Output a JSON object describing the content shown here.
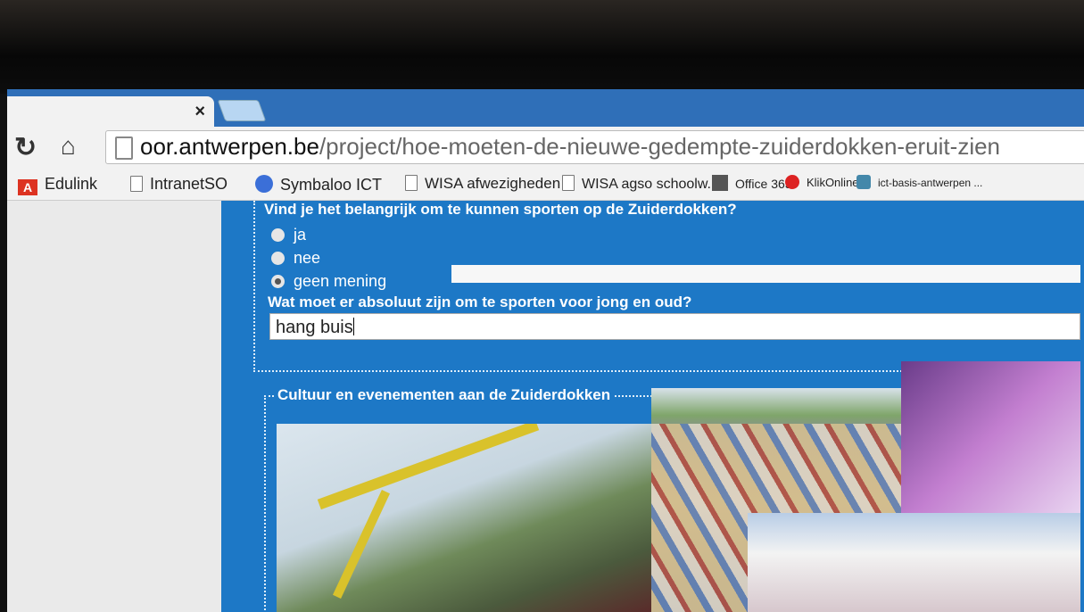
{
  "browser": {
    "tab_close": "×",
    "url_host": "oor.antwerpen.be",
    "url_path": "/project/hoe-moeten-de-nieuwe-gedempte-zuiderdokken-eruit-zien"
  },
  "bookmarks": [
    {
      "label": "Edulink",
      "icon": "acrobat-icon"
    },
    {
      "label": "IntranetSO",
      "icon": "page-icon"
    },
    {
      "label": "Symbaloo ICT",
      "icon": "symbaloo-icon"
    },
    {
      "label": "WISA afwezigheden",
      "icon": "page-icon"
    },
    {
      "label": "WISA agso schoolw...",
      "icon": "page-icon"
    },
    {
      "label": "Office 365",
      "icon": "office-icon"
    },
    {
      "label": "KlikOnline",
      "icon": "klikonline-icon"
    },
    {
      "label": "ict-basis-antwerpen ...",
      "icon": "ict-icon"
    }
  ],
  "form": {
    "question1": "Vind je het belangrijk om te kunnen sporten op de Zuiderdokken?",
    "options": [
      {
        "label": "ja",
        "selected": false
      },
      {
        "label": "nee",
        "selected": false
      },
      {
        "label": "geen mening",
        "selected": true
      }
    ],
    "question2": "Wat moet er absoluut zijn om te sporten voor jong en oud?",
    "answer2": "hang buis",
    "section2_title": "Cultuur en evenementen aan de Zuiderdokken"
  }
}
